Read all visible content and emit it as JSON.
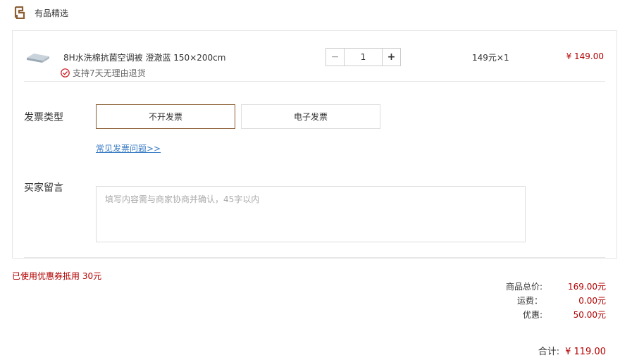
{
  "shop": {
    "title": "有品精选",
    "logo_icon": "shop-logo-icon"
  },
  "item": {
    "name": "8H水洗棉抗菌空调被 澄澈蓝 150×200cm",
    "guarantee": "支持7天无理由退货",
    "quantity": "1",
    "minus_label": "−",
    "plus_label": "+",
    "unit_price": "149元×1",
    "line_total": "¥ 149.00"
  },
  "invoice": {
    "label": "发票类型",
    "options": [
      "不开发票",
      "电子发票"
    ],
    "selected": "不开发票",
    "faq_link": "常见发票问题>>"
  },
  "message": {
    "label": "买家留言",
    "placeholder": "填写内容需与商家协商并确认，45字以内"
  },
  "coupon_note": "已使用优惠券抵用 30元",
  "summary": {
    "rows": [
      {
        "key": "商品总价:",
        "value": "169.00元"
      },
      {
        "key": "运费：",
        "value": "0.00元"
      },
      {
        "key": "优惠:",
        "value": "50.00元"
      }
    ],
    "total_label": "合计:",
    "total_value": "¥ 119.00"
  },
  "colors": {
    "accent": "#8b5e34",
    "price": "#b30000",
    "link": "#3b7dc4"
  }
}
